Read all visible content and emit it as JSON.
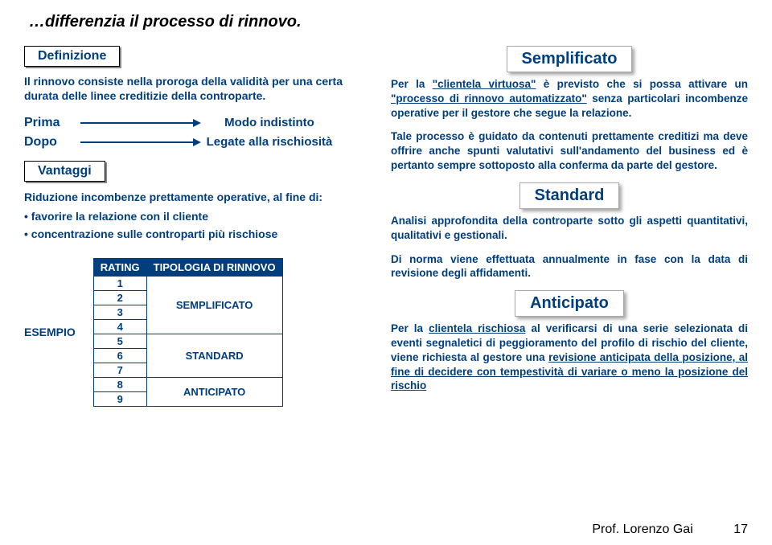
{
  "title": "…differenzia il processo di rinnovo.",
  "definition_label": "Definizione",
  "definition_text": "Il rinnovo consiste nella proroga della validità per una certa durata delle linee creditizie della controparte.",
  "prima": {
    "label": "Prima",
    "value": "Modo indistinto"
  },
  "dopo": {
    "label": "Dopo",
    "value": "Legate alla rischiosità"
  },
  "vantaggi_label": "Vantaggi",
  "vantaggi_text": "Riduzione incombenze prettamente operative, al fine di:",
  "vantaggi_bullets": [
    "favorire la relazione con il cliente",
    "concentrazione sulle controparti più rischiose"
  ],
  "esempio_label": "ESEMPIO",
  "table": {
    "header_rating": "RATING",
    "header_tipo": "TIPOLOGIA DI RINNOVO",
    "groups": [
      {
        "ratings": [
          "1",
          "2",
          "3",
          "4"
        ],
        "tipo": "SEMPLIFICATO"
      },
      {
        "ratings": [
          "5",
          "6",
          "7"
        ],
        "tipo": "STANDARD"
      },
      {
        "ratings": [
          "8",
          "9"
        ],
        "tipo": "ANTICIPATO"
      }
    ]
  },
  "right": {
    "semplificato_label": "Semplificato",
    "semp_p1_a": "Per la ",
    "semp_p1_u1": "\"clientela virtuosa\"",
    "semp_p1_b": " è previsto che si possa attivare un ",
    "semp_p1_u2": "\"processo di rinnovo automatizzato\"",
    "semp_p1_c": " senza particolari incombenze operative per il gestore che segue la relazione.",
    "semp_p2": "Tale processo è guidato da contenuti prettamente creditizi ma deve offrire anche spunti valutativi sull'andamento del business ed è pertanto sempre sottoposto alla conferma da parte del gestore.",
    "standard_label": "Standard",
    "std_p1": "Analisi approfondita della controparte sotto gli aspetti quantitativi, qualitativi e gestionali.",
    "std_p2": "Di norma viene effettuata annualmente in fase con la data di revisione degli affidamenti.",
    "anticipato_label": "Anticipato",
    "ant_p1_a": "Per la ",
    "ant_p1_u1": "clientela rischiosa",
    "ant_p1_b": " al verificarsi di una serie selezionata di eventi segnaletici di peggioramento del profilo di rischio del cliente, viene richiesta al gestore una ",
    "ant_p1_u2": "revisione anticipata della posizione, al fine di decidere con tempestività di variare o meno la posizione del rischio"
  },
  "footer_author": "Prof. Lorenzo Gai",
  "footer_page": "17"
}
